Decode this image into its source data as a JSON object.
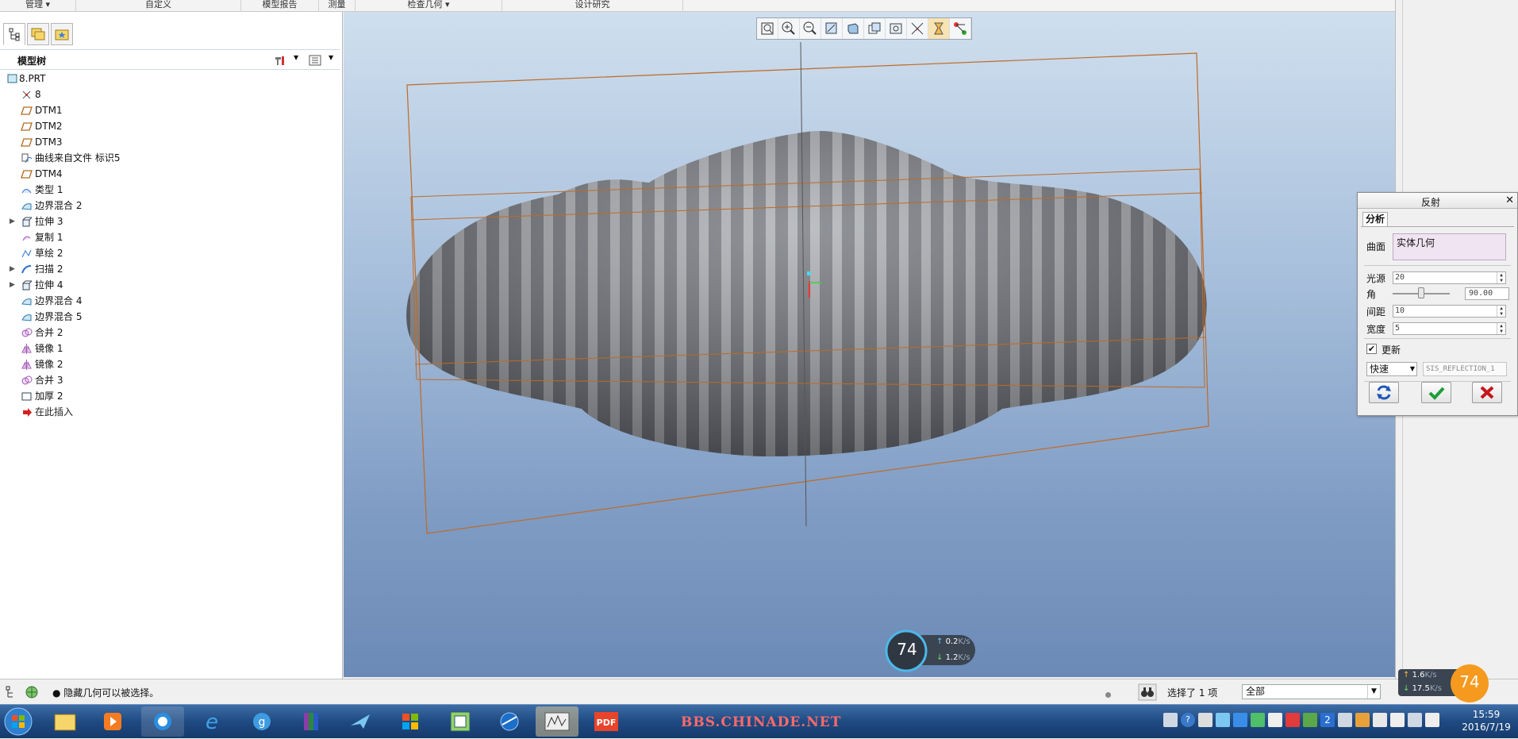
{
  "ribbon": {
    "groups": [
      "管理 ▾",
      "自定义",
      "模型报告",
      "测量",
      "检查几何 ▾",
      "设计研究"
    ]
  },
  "model_tree": {
    "title": "模型树",
    "items": [
      {
        "label": "8.PRT",
        "icon": "part-icon",
        "expandable": false,
        "root": true
      },
      {
        "label": "8",
        "icon": "csys-icon",
        "expandable": false
      },
      {
        "label": "DTM1",
        "icon": "datum-plane-icon",
        "expandable": false
      },
      {
        "label": "DTM2",
        "icon": "datum-plane-icon",
        "expandable": false
      },
      {
        "label": "DTM3",
        "icon": "datum-plane-icon",
        "expandable": false
      },
      {
        "label": "曲线来自文件 标识5",
        "icon": "curve-from-file-icon",
        "expandable": false
      },
      {
        "label": "DTM4",
        "icon": "datum-plane-icon",
        "expandable": false
      },
      {
        "label": "类型 1",
        "icon": "surface-type-icon",
        "expandable": false
      },
      {
        "label": "边界混合 2",
        "icon": "boundary-blend-icon",
        "expandable": false
      },
      {
        "label": "拉伸 3",
        "icon": "extrude-icon",
        "expandable": true
      },
      {
        "label": "复制 1",
        "icon": "copy-icon",
        "expandable": false
      },
      {
        "label": "草绘 2",
        "icon": "sketch-icon",
        "expandable": false
      },
      {
        "label": "扫描 2",
        "icon": "sweep-icon",
        "expandable": true
      },
      {
        "label": "拉伸 4",
        "icon": "extrude-icon",
        "expandable": true
      },
      {
        "label": "边界混合 4",
        "icon": "boundary-blend-icon",
        "expandable": false
      },
      {
        "label": "边界混合 5",
        "icon": "boundary-blend-icon",
        "expandable": false
      },
      {
        "label": "合并 2",
        "icon": "merge-icon",
        "expandable": false
      },
      {
        "label": "镜像 1",
        "icon": "mirror-icon",
        "expandable": false
      },
      {
        "label": "镜像 2",
        "icon": "mirror-icon",
        "expandable": false
      },
      {
        "label": "合并 3",
        "icon": "merge-icon",
        "expandable": false
      },
      {
        "label": "加厚 2",
        "icon": "thicken-icon",
        "expandable": false
      },
      {
        "label": "在此插入",
        "icon": "insert-here-arrow-icon",
        "expandable": false
      }
    ]
  },
  "reflection_dialog": {
    "title": "反射",
    "tab": "分析",
    "surface_label": "曲面",
    "surface_value": "实体几何",
    "light_label": "光源",
    "light_value": "20",
    "angle_label": "角",
    "angle_value": "90.00",
    "spacing_label": "间距",
    "spacing_value": "10",
    "width_label": "宽度",
    "width_value": "5",
    "update_label": "更新",
    "update_checked": true,
    "mode_value": "快速",
    "name_value": "SIS_REFLECTION_1"
  },
  "status": {
    "message": "● 隐藏几何可以被选择。",
    "selection": "选择了 1 项",
    "filter": "全部"
  },
  "net_meter_center": {
    "percent": "74",
    "up": "0.2",
    "down": "1.2",
    "unit": "K/s"
  },
  "net_meter_corner": {
    "percent": "74",
    "up": "1.6",
    "down": "17.5",
    "unit": "K/s"
  },
  "taskbar": {
    "watermark": "BBS.CHINADE.NET",
    "time": "15:59",
    "date": "2016/7/19"
  },
  "colors": {
    "accent_orange": "#c87a3c",
    "dialog_surface_bg": "#f1e4f2",
    "taskbar_blue": "#1f4a82"
  }
}
